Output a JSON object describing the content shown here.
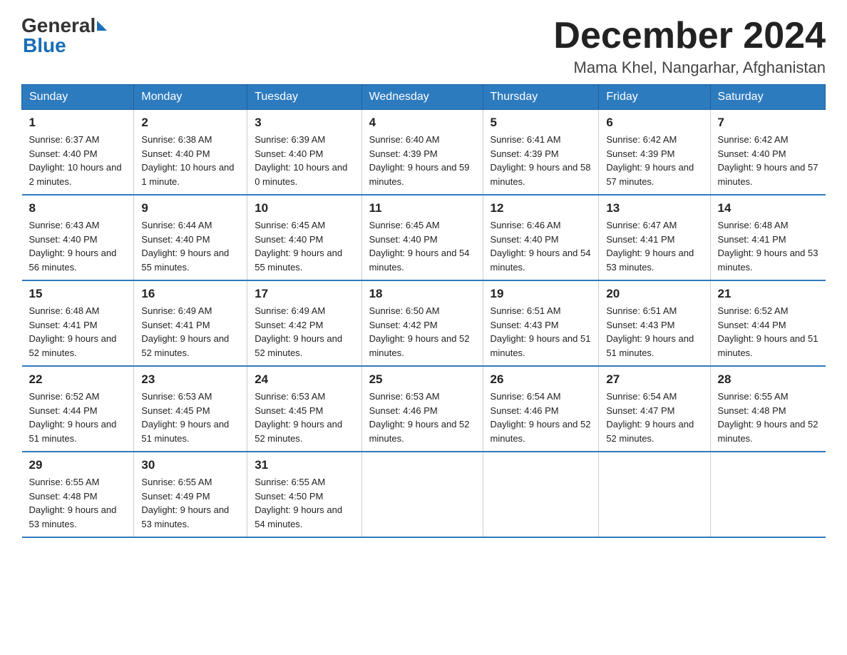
{
  "header": {
    "logo_general": "General",
    "logo_blue": "Blue",
    "month_title": "December 2024",
    "location": "Mama Khel, Nangarhar, Afghanistan"
  },
  "weekdays": [
    "Sunday",
    "Monday",
    "Tuesday",
    "Wednesday",
    "Thursday",
    "Friday",
    "Saturday"
  ],
  "weeks": [
    [
      {
        "day": "1",
        "sunrise": "6:37 AM",
        "sunset": "4:40 PM",
        "daylight": "10 hours and 2 minutes."
      },
      {
        "day": "2",
        "sunrise": "6:38 AM",
        "sunset": "4:40 PM",
        "daylight": "10 hours and 1 minute."
      },
      {
        "day": "3",
        "sunrise": "6:39 AM",
        "sunset": "4:40 PM",
        "daylight": "10 hours and 0 minutes."
      },
      {
        "day": "4",
        "sunrise": "6:40 AM",
        "sunset": "4:39 PM",
        "daylight": "9 hours and 59 minutes."
      },
      {
        "day": "5",
        "sunrise": "6:41 AM",
        "sunset": "4:39 PM",
        "daylight": "9 hours and 58 minutes."
      },
      {
        "day": "6",
        "sunrise": "6:42 AM",
        "sunset": "4:39 PM",
        "daylight": "9 hours and 57 minutes."
      },
      {
        "day": "7",
        "sunrise": "6:42 AM",
        "sunset": "4:40 PM",
        "daylight": "9 hours and 57 minutes."
      }
    ],
    [
      {
        "day": "8",
        "sunrise": "6:43 AM",
        "sunset": "4:40 PM",
        "daylight": "9 hours and 56 minutes."
      },
      {
        "day": "9",
        "sunrise": "6:44 AM",
        "sunset": "4:40 PM",
        "daylight": "9 hours and 55 minutes."
      },
      {
        "day": "10",
        "sunrise": "6:45 AM",
        "sunset": "4:40 PM",
        "daylight": "9 hours and 55 minutes."
      },
      {
        "day": "11",
        "sunrise": "6:45 AM",
        "sunset": "4:40 PM",
        "daylight": "9 hours and 54 minutes."
      },
      {
        "day": "12",
        "sunrise": "6:46 AM",
        "sunset": "4:40 PM",
        "daylight": "9 hours and 54 minutes."
      },
      {
        "day": "13",
        "sunrise": "6:47 AM",
        "sunset": "4:41 PM",
        "daylight": "9 hours and 53 minutes."
      },
      {
        "day": "14",
        "sunrise": "6:48 AM",
        "sunset": "4:41 PM",
        "daylight": "9 hours and 53 minutes."
      }
    ],
    [
      {
        "day": "15",
        "sunrise": "6:48 AM",
        "sunset": "4:41 PM",
        "daylight": "9 hours and 52 minutes."
      },
      {
        "day": "16",
        "sunrise": "6:49 AM",
        "sunset": "4:41 PM",
        "daylight": "9 hours and 52 minutes."
      },
      {
        "day": "17",
        "sunrise": "6:49 AM",
        "sunset": "4:42 PM",
        "daylight": "9 hours and 52 minutes."
      },
      {
        "day": "18",
        "sunrise": "6:50 AM",
        "sunset": "4:42 PM",
        "daylight": "9 hours and 52 minutes."
      },
      {
        "day": "19",
        "sunrise": "6:51 AM",
        "sunset": "4:43 PM",
        "daylight": "9 hours and 51 minutes."
      },
      {
        "day": "20",
        "sunrise": "6:51 AM",
        "sunset": "4:43 PM",
        "daylight": "9 hours and 51 minutes."
      },
      {
        "day": "21",
        "sunrise": "6:52 AM",
        "sunset": "4:44 PM",
        "daylight": "9 hours and 51 minutes."
      }
    ],
    [
      {
        "day": "22",
        "sunrise": "6:52 AM",
        "sunset": "4:44 PM",
        "daylight": "9 hours and 51 minutes."
      },
      {
        "day": "23",
        "sunrise": "6:53 AM",
        "sunset": "4:45 PM",
        "daylight": "9 hours and 51 minutes."
      },
      {
        "day": "24",
        "sunrise": "6:53 AM",
        "sunset": "4:45 PM",
        "daylight": "9 hours and 52 minutes."
      },
      {
        "day": "25",
        "sunrise": "6:53 AM",
        "sunset": "4:46 PM",
        "daylight": "9 hours and 52 minutes."
      },
      {
        "day": "26",
        "sunrise": "6:54 AM",
        "sunset": "4:46 PM",
        "daylight": "9 hours and 52 minutes."
      },
      {
        "day": "27",
        "sunrise": "6:54 AM",
        "sunset": "4:47 PM",
        "daylight": "9 hours and 52 minutes."
      },
      {
        "day": "28",
        "sunrise": "6:55 AM",
        "sunset": "4:48 PM",
        "daylight": "9 hours and 52 minutes."
      }
    ],
    [
      {
        "day": "29",
        "sunrise": "6:55 AM",
        "sunset": "4:48 PM",
        "daylight": "9 hours and 53 minutes."
      },
      {
        "day": "30",
        "sunrise": "6:55 AM",
        "sunset": "4:49 PM",
        "daylight": "9 hours and 53 minutes."
      },
      {
        "day": "31",
        "sunrise": "6:55 AM",
        "sunset": "4:50 PM",
        "daylight": "9 hours and 54 minutes."
      },
      null,
      null,
      null,
      null
    ]
  ]
}
